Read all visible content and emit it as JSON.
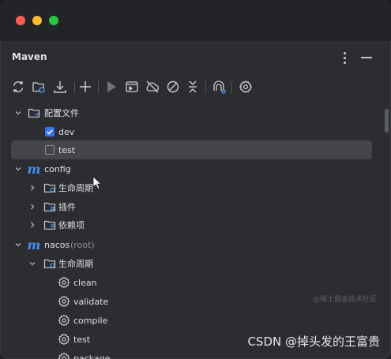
{
  "window": {
    "traffic_lights": [
      "close",
      "minimize",
      "maximize"
    ],
    "colors": {
      "close": "#ff5f57",
      "minimize": "#febc2e",
      "maximize": "#28c840"
    }
  },
  "panel": {
    "title": "Maven"
  },
  "toolbar": {
    "buttons": [
      {
        "icon": "reload-icon"
      },
      {
        "icon": "generate-sources-icon"
      },
      {
        "icon": "download-icon"
      },
      {
        "icon": "add-icon"
      },
      {
        "icon": "run-icon"
      },
      {
        "icon": "execute-goal-icon"
      },
      {
        "icon": "offline-icon"
      },
      {
        "icon": "skip-tests-icon"
      },
      {
        "icon": "collapse-all-icon"
      },
      {
        "icon": "dependency-analyzer-icon"
      },
      {
        "icon": "settings-icon"
      }
    ]
  },
  "tree": {
    "profiles_label": "配置文件",
    "profile_dev": "dev",
    "profile_dev_checked": true,
    "profile_test": "test",
    "profile_test_checked": false,
    "config_label": "config",
    "config_lifecycle": "生命周期",
    "config_plugins": "插件",
    "config_dependencies": "依赖项",
    "nacos_label": "nacos",
    "nacos_suffix": "(root)",
    "nacos_lifecycle": "生命周期",
    "goals": [
      "clean",
      "validate",
      "compile",
      "test",
      "package"
    ]
  },
  "accent_color": "#3574f0",
  "maven_icon_color": "#4d8bf4",
  "watermark": {
    "text": "CSDN @掉头发的王富贵",
    "faint": "@稀土掘金技术社区"
  }
}
